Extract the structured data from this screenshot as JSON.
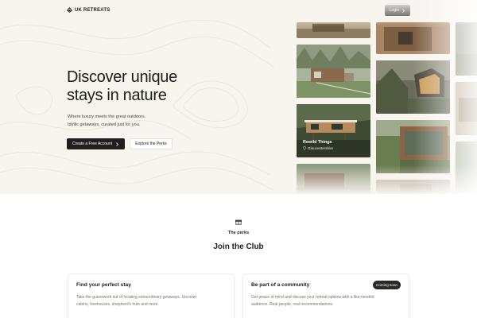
{
  "header": {
    "brand": "UK RETREATS",
    "login_label": "Login"
  },
  "hero": {
    "headline_line1": "Discover unique",
    "headline_line2": "stays in nature",
    "subtitle_line1": "Where luxury meets the great outdoors.",
    "subtitle_line2": "Idyllic getaways, curated just for you.",
    "primary_cta": "Create a Free Account",
    "secondary_cta": "Explore the Perks"
  },
  "featured": {
    "title": "Rewild Things",
    "location": "Gloucestershire"
  },
  "perks": {
    "eyebrow": "The perks",
    "title": "Join the Club"
  },
  "cards": [
    {
      "title": "Find your perfect stay",
      "text": "Take the guesswork out of locating extraordinary getaways. Uncover cabins, treehouses, shepherd's huts and more."
    },
    {
      "title": "Be part of a community",
      "badge": "Coming soon",
      "text": "Get peace of mind and discuss your retreat options with a like-minded audience. Real people, real recommendations."
    }
  ],
  "colors": {
    "hero_bg": "#f8f4ee",
    "dark": "#201f1d",
    "text": "#1f1d1a",
    "muted": "#77726b"
  },
  "icons": {
    "brand": "brand-logo-icon",
    "login_arrow": "chevron-right-icon",
    "cta_arrow": "chevron-right-icon",
    "location": "location-pin-icon",
    "perks": "gift-icon"
  }
}
